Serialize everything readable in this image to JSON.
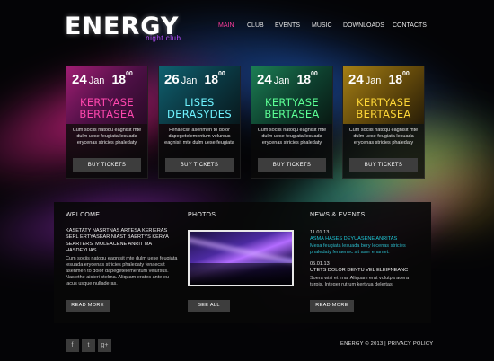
{
  "logo": {
    "title": "ENERGY",
    "subtitle": "night club"
  },
  "nav": [
    "MAIN",
    "CLUB",
    "EVENTS",
    "MUSIC",
    "DOWNLOADS",
    "CONTACTS"
  ],
  "active_nav": "MAIN",
  "cards": [
    {
      "day": "24",
      "month": "Jan",
      "hour": "18",
      "minutes": "00",
      "title_line1": "KERTYASE",
      "title_line2": "BERTASEA",
      "description": "Cum sociis natoqu eagnisit mte dulm uese feugiata lesuada erycenas stricies phaledaty",
      "button": "BUY TICKETS",
      "accent": "#ff47ae"
    },
    {
      "day": "26",
      "month": "Jan",
      "hour": "18",
      "minutes": "00",
      "title_line1": "LISES",
      "title_line2": "DERASYDES",
      "description": "Fenaecsit asenmen to dolor dapegetelementum velursus eagnisit mte dulm uese feugiata",
      "button": "BUY TICKETS",
      "accent": "#6ff3ff"
    },
    {
      "day": "24",
      "month": "Jan",
      "hour": "18",
      "minutes": "00",
      "title_line1": "KERTYASE",
      "title_line2": "BERTASEA",
      "description": "Cum sociis natoqu eagnisit mte dulm uese feugiata lesuada erycenas stricies phaledaty",
      "button": "BUY TICKETS",
      "accent": "#5cff95"
    },
    {
      "day": "24",
      "month": "Jan",
      "hour": "18",
      "minutes": "00",
      "title_line1": "KERTYASE",
      "title_line2": "BERTASEA",
      "description": "Cum sociis natoqu eagnisit mte dulm uese feugiata lesuada erycenas stricies phaledaty",
      "button": "BUY TICKETS",
      "accent": "#ffd838"
    }
  ],
  "welcome": {
    "title": "WELCOME",
    "heading": "KASETATY NASRTNAS ARTESA KERIERAS SERL ERTYASEAR NIAST BAERTYS KERYA SEARTERS. MOLEACENE ANRIT MA HASDEYUAS",
    "body": "Cum sociis natoqu eagnisit mte dulm uese feugiata lesuada erycenas stricies phaledaty fenaecsit asenmen to dolor dapegetelementum velursus. Naslethe aicteri stelma. Aliquam erates ante eu lacus usque nulladeras.",
    "button": "READ MORE"
  },
  "photos": {
    "title": "PHOTOS",
    "button": "SEE ALL"
  },
  "news": {
    "title": "NEWS & EVENTS",
    "items": [
      {
        "date": "11.01.13",
        "headline": "ASMA HASES DEYUASENE ANRITAS",
        "text": "Mesa feugiata lesuada bery lecenas stricies phaledaty fenaenec sit aser enamet."
      },
      {
        "date": "05.01.13",
        "headline": "UTETS DOLOR DENTU VEL ELEIFNEANC",
        "text": "Soera wisi et ima. Aliquam erat volutpa acera turpis. Integer rutrum kertyua delertas."
      }
    ],
    "button": "READ MORE"
  },
  "social": [
    {
      "label": "f",
      "icon": "facebook-icon"
    },
    {
      "label": "t",
      "icon": "twitter-icon"
    },
    {
      "label": "g+",
      "icon": "google-plus-icon"
    }
  ],
  "footer": {
    "copyright": "ENERGY © 2013 | PRIVACY POLICY"
  }
}
